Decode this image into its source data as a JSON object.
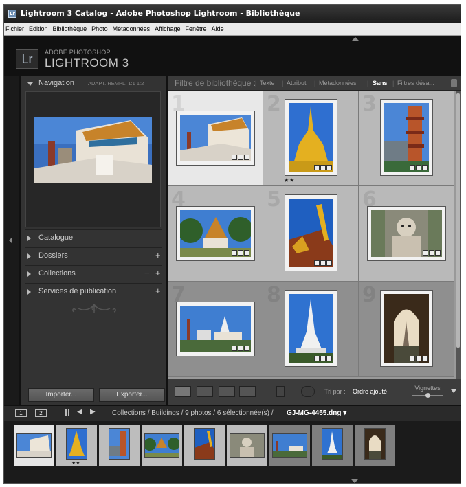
{
  "window": {
    "title": "Lightroom 3 Catalog - Adobe Photoshop Lightroom - Bibliothèque",
    "icon": "app-icon"
  },
  "menu": [
    "Fichier",
    "Edition",
    "Bibliothèque",
    "Photo",
    "Métadonnées",
    "Affichage",
    "Fenêtre",
    "Aide"
  ],
  "identity": {
    "logo": "Lr",
    "line1": "ADOBE PHOTOSHOP",
    "line2": "LIGHTROOM 3"
  },
  "left_panel": {
    "navigator": {
      "label": "Navigation",
      "zoom": "ADAPT. REMPL. 1:1 1:2"
    },
    "sections": [
      {
        "label": "Catalogue"
      },
      {
        "label": "Dossiers",
        "plus": "+"
      },
      {
        "label": "Collections",
        "minus": "−",
        "plus": "+"
      },
      {
        "label": "Services de publication",
        "plus": "+"
      }
    ],
    "import": "Importer...",
    "export": "Exporter..."
  },
  "filter_bar": {
    "title": "Filtre de bibliothèque :",
    "texte": "Texte",
    "attribut": "Attribut",
    "metadonnees": "Métadonnées",
    "sans": "Sans",
    "filtres": "Filtres désa..."
  },
  "grid": [
    {
      "num": "1",
      "subject": "temple-white",
      "stars": ""
    },
    {
      "num": "2",
      "subject": "golden-stupa",
      "stars": "★★"
    },
    {
      "num": "3",
      "subject": "pagoda-tower",
      "stars": ""
    },
    {
      "num": "4",
      "subject": "temple-trees",
      "stars": ""
    },
    {
      "num": "5",
      "subject": "roof-finial",
      "stars": ""
    },
    {
      "num": "6",
      "subject": "demon-statue",
      "stars": ""
    },
    {
      "num": "7",
      "subject": "city-skyline",
      "stars": ""
    },
    {
      "num": "8",
      "subject": "white-stupa",
      "stars": ""
    },
    {
      "num": "9",
      "subject": "arch-window",
      "stars": ""
    }
  ],
  "toolbar": {
    "sort_label": "Tri par :",
    "sort_value": "Ordre ajouté",
    "thumbs_label": "Vignettes"
  },
  "filmstrip_bar": {
    "mon1": "1",
    "mon2": "2",
    "path": "Collections / Buildings / 9 photos / 6 sélectionnée(s) /",
    "file": "GJ-MG-4455.dng ▾",
    "prev": "◀",
    "next": "▶"
  },
  "filmstrip": {
    "selected_count": 6,
    "stars_first_row_item2": "★★"
  },
  "colors": {
    "panel": "#333333",
    "grid_selected": "#e6e6e6",
    "grid_normal": "#b8b8b8",
    "grid_dim": "#8f8f8f"
  }
}
